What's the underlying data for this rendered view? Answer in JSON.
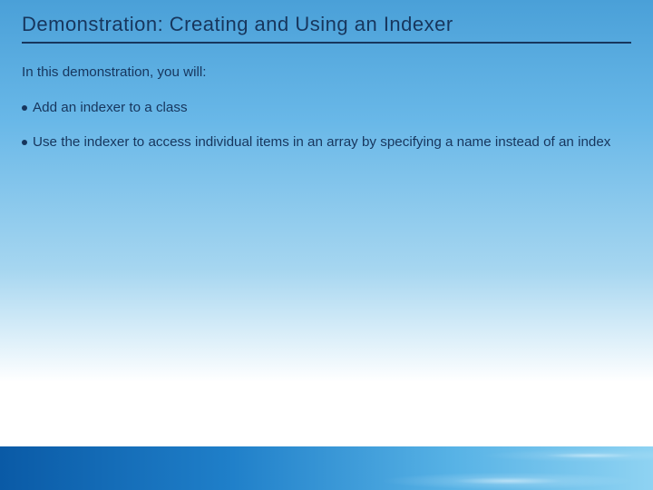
{
  "title": "Demonstration: Creating and Using an Indexer",
  "intro": "In this demonstration, you will:",
  "bullets": [
    "Add an indexer to a class",
    "Use the indexer to access individual items in an array by specifying a name instead of an index"
  ]
}
